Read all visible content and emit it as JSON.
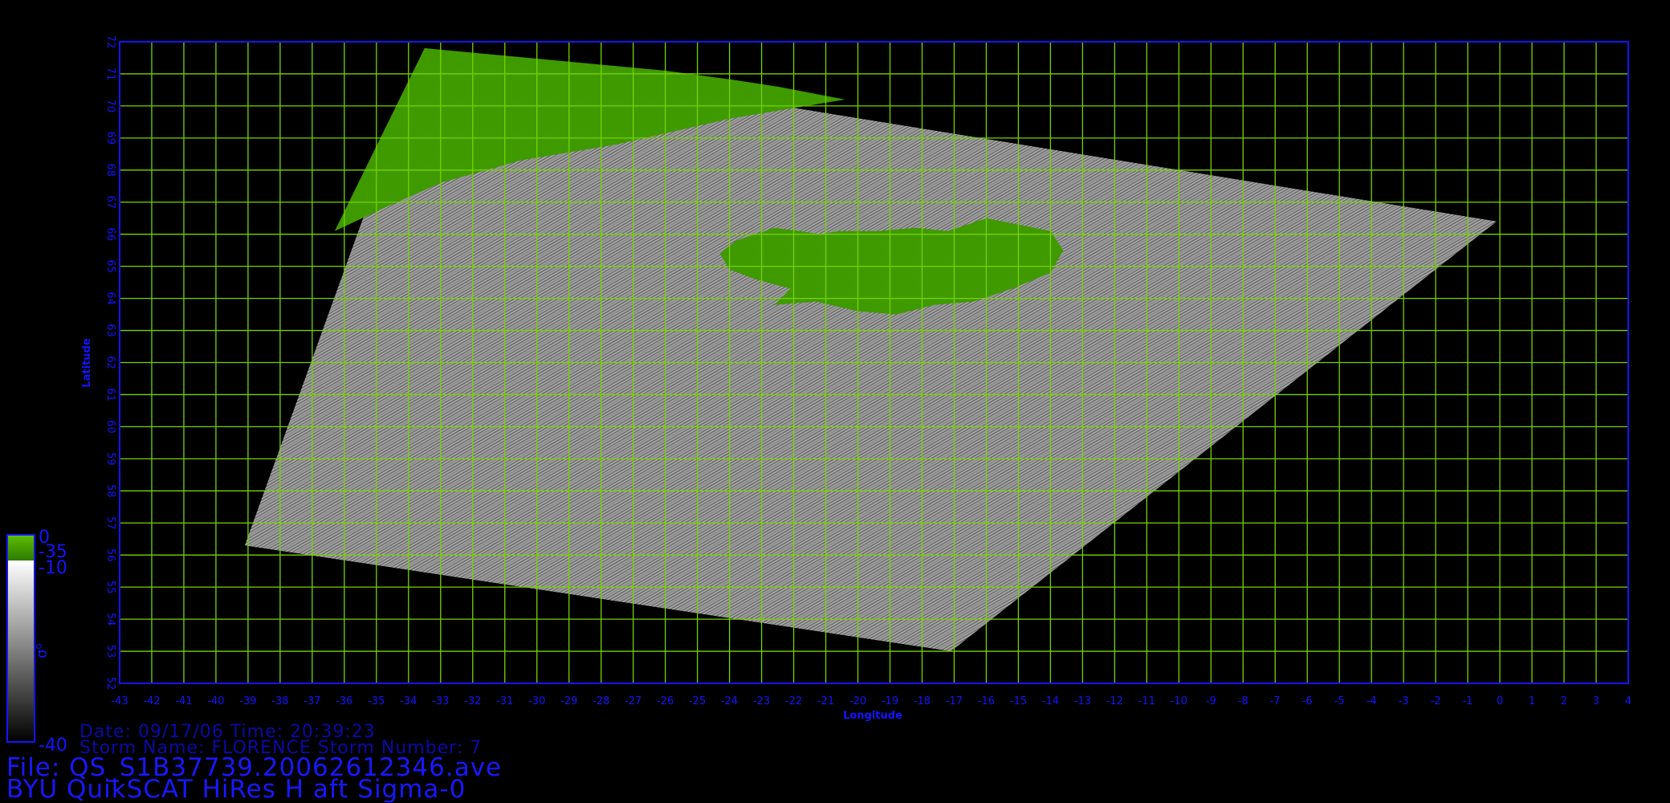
{
  "map": {
    "xlabel": "Longitude",
    "ylabel": "Latitude",
    "lon_range": [
      -43,
      4
    ],
    "lat_range": [
      52,
      72
    ],
    "x_ticks": [
      "-43",
      "-42",
      "-41",
      "-40",
      "-39",
      "-38",
      "-37",
      "-36",
      "-35",
      "-34",
      "-33",
      "-32",
      "-31",
      "-30",
      "-29",
      "-28",
      "-27",
      "-26",
      "-25",
      "-24",
      "-23",
      "-22",
      "-21",
      "-20",
      "-19",
      "-18",
      "-17",
      "-16",
      "-15",
      "-14",
      "-13",
      "-12",
      "-11",
      "-10",
      "-9",
      "-8",
      "-7",
      "-6",
      "-5",
      "-4",
      "-3",
      "-2",
      "-1",
      "0",
      "1",
      "2",
      "3",
      "4"
    ],
    "y_ticks": [
      "52",
      "53",
      "54",
      "55",
      "56",
      "57",
      "58",
      "59",
      "60",
      "61",
      "62",
      "63",
      "64",
      "65",
      "66",
      "67",
      "68",
      "69",
      "70",
      "71",
      "72"
    ],
    "grid": true,
    "colors": {
      "frame": "#1414ff",
      "grid": "#74d400",
      "land": "#3f9a00",
      "ocean": "#8c8c8c"
    },
    "swath_corners_lonlat": [
      [
        -33.5,
        71.8
      ],
      [
        -0.1,
        66.4
      ],
      [
        -17.1,
        53.0
      ],
      [
        -39.1,
        56.3
      ]
    ]
  },
  "colorbar": {
    "top_label": "0",
    "label_2": "-35",
    "label_3": "-10",
    "bottom_label": "-40",
    "symbol": "σ⁰",
    "land_color": "#3f9a00"
  },
  "meta": {
    "date_line": "Date: 09/17/06   Time: 20:39:23",
    "storm_line": "Storm Name: FLORENCE   Storm Number: 7",
    "file_line": "File: QS_S1B37739.20062612346.ave",
    "product_line": "BYU QuikSCAT HiRes H aft Sigma-0"
  }
}
